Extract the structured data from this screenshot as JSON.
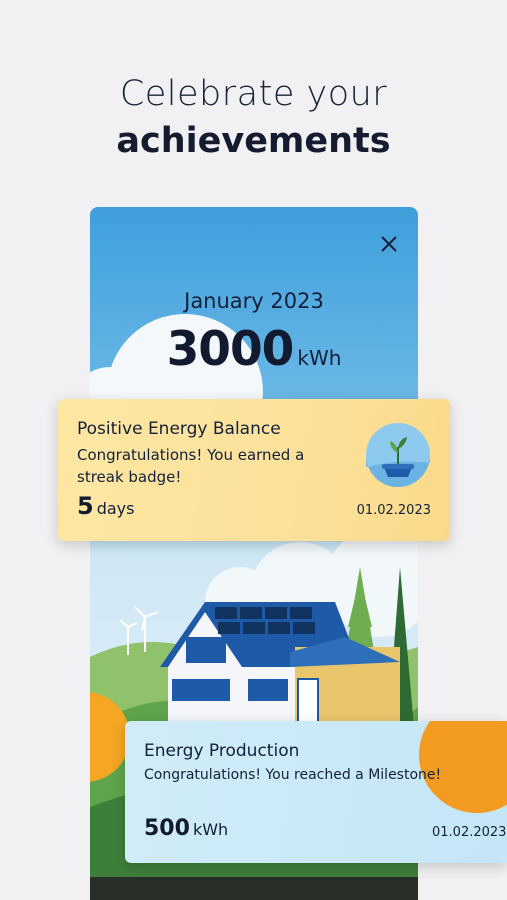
{
  "headline": {
    "line1": "Celebrate your",
    "line2": "achievements"
  },
  "summary": {
    "month": "January 2023",
    "value": "3000",
    "unit": "kWh"
  },
  "cards": [
    {
      "title": "Positive Energy Balance",
      "message": "Congratulations! You earned a streak badge!",
      "value": "5",
      "unit": "days",
      "date": "01.02.2023",
      "icon": "plant-badge-icon"
    },
    {
      "title": "Energy Production",
      "message": "Congratulations! You reached a Milestone!",
      "value": "500",
      "unit": "kWh",
      "date": "01.02.2023",
      "icon": "sun-icon"
    }
  ],
  "colors": {
    "sky": "#4aa6e0",
    "card_yellow": "#fce19a",
    "card_blue": "#c8e8f8",
    "sun": "#f5a623"
  }
}
